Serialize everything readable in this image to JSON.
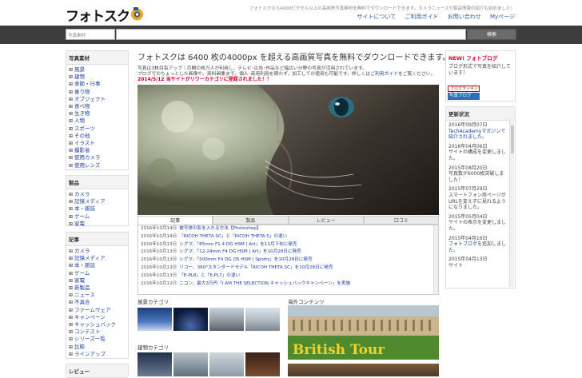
{
  "header": {
    "logo_text": "フォトスク",
    "tagline": "フォトスクなら4000ピクセル以上の高画質写真素材を無料でダウンロードできます。カメラニュースや製品情報の紹介も始めました！",
    "nav": [
      "サイトについて",
      "ご利用ガイド",
      "お問い合わせ",
      "Myページ"
    ]
  },
  "search": {
    "label": "写真素材",
    "placeholder": "",
    "button": "検索"
  },
  "sidebar": {
    "photo_title": "写真素材",
    "photo_items": [
      "風景",
      "建物",
      "季節・行事",
      "乗り物",
      "オブジェクト",
      "食べ物",
      "生き物",
      "人物",
      "スポーツ",
      "その他",
      "イラスト",
      "撮影者",
      "使用カメラ",
      "使用レンズ"
    ],
    "product_title": "製品",
    "product_items": [
      "カメラ",
      "記憶メディア",
      "本・雑誌",
      "ゲーム",
      "家電"
    ],
    "article_title": "記事",
    "article_items": [
      "カメラ",
      "記憶メディア",
      "本・雑誌",
      "ゲーム",
      "家電",
      "新製品",
      "ニュース",
      "不具合",
      "ファームウェア",
      "キャンペーン",
      "キャッシュバック",
      "コンテスト",
      "シリーズ一覧",
      "比較",
      "ラインアップ"
    ],
    "review_title": "レビュー"
  },
  "main": {
    "title": "フォトスクは 6400 枚の4000px を超える高画質写真を無料でダウンロードできます。",
    "desc1": "写真は3枚目毎アップ｜月間の枚万人が利用し、テレビ･広告･作品など幅広い分野の写真が活用されています。",
    "desc2_pre": "ブログでのちょっとした画像や、資料画像まで、個人･商用利用を問わず、加工しての使用も可能です。詳しくは",
    "desc2_link": "ご利用ガイド",
    "desc2_post": "をご覧ください。",
    "notice": "2014/5/12 当サイトがリワーカテゴリに登録されました！！"
  },
  "tabs": [
    "記事",
    "製品",
    "レビュー",
    "口コミ"
  ],
  "news": [
    {
      "date": "2016年10月14日",
      "title": "被写体の影を入れる方法【Photoshop】"
    },
    {
      "date": "2016年10月14日",
      "title": "「RICOH THETA SC」と「RICOH THETA S」の違い"
    },
    {
      "date": "2016年10月13日",
      "title": "シグマ、「85mm F1.4 DG HSM | Art」を11月下旬に発売"
    },
    {
      "date": "2016年10月13日",
      "title": "シグマ、「12-24mm F4 DG HSM | Art」を10月28日に発売"
    },
    {
      "date": "2016年10月13日",
      "title": "シグマ、「500mm F4 DG OS HSM | Sports」を10月28日に発売"
    },
    {
      "date": "2016年10月13日",
      "title": "リコー、360°スタンダードモデル「RICOH THETA SC」を10月28日に発売"
    },
    {
      "date": "2016年10月13日",
      "title": "「E-PL8」と「E-PL7」の違い"
    },
    {
      "date": "2016年10月12日",
      "title": "ニコン、最大3万円「I AM THE SELECTION キャッシュバックキャンペーン」を実施"
    }
  ],
  "sections": {
    "landscape": "風景カテゴリ",
    "building": "建物カテゴリ",
    "overseas": "海外コンテンツ",
    "british_tour": "British Tour"
  },
  "right": {
    "new_title": "NEW! フォトブログ",
    "new_desc": "ブログ形式で写真を紹介しています！",
    "badge1": "ブログランキング",
    "badge2": "写真ブログ",
    "update_title": "更新状況",
    "updates": [
      {
        "date": "2016年09月07日",
        "text": "TechAcademyマガジンで紹介されました。"
      },
      {
        "date": "2016年04月06日",
        "text": "サイトの構成を変更しました。"
      },
      {
        "date": "2015年08月20日",
        "text": "写真数が6000枚突破しました！"
      },
      {
        "date": "2015年07月29日",
        "text": "スマートフォン用ページがURLを変えずに見れるようになりました。"
      },
      {
        "date": "2015年05月04日",
        "text": "サイトの表示を変更しました。"
      },
      {
        "date": "2015年04月16日",
        "text_pre": "",
        "link": "フォトブログ",
        "text_post": "を追加しました。"
      },
      {
        "date": "2015年04月13日",
        "text": "サイト"
      }
    ]
  }
}
